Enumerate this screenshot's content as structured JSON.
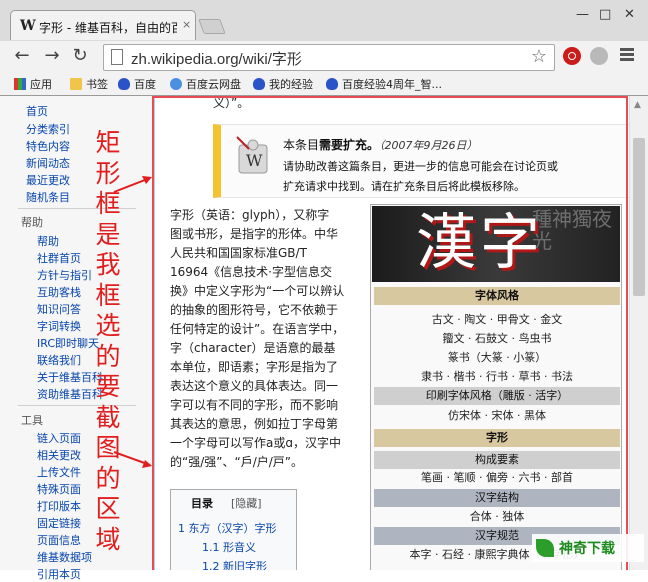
{
  "browser": {
    "tab_title": "字形 - 维基百科，自由的百科全书",
    "tab_icon": "W",
    "tab_close": "×",
    "url": "zh.wikipedia.org/wiki/字形",
    "window_min": "—",
    "window_max": "□",
    "window_close": "✕",
    "bookmarks": [
      "应用",
      "书签",
      "百度",
      "百度云网盘",
      "我的经验",
      "百度经验4周年_智..."
    ]
  },
  "sidebar": {
    "nav": [
      "首页",
      "分类索引",
      "特色内容",
      "新闻动态",
      "最近更改",
      "随机条目"
    ],
    "help_title": "帮助",
    "help_items": [
      "帮助",
      "社群首页",
      "方针与指引",
      "互助客栈",
      "知识问答",
      "字词转换",
      "IRC即时聊天",
      "联络我们",
      "关于维基百科",
      "资助维基百科"
    ],
    "tools_title": "工具",
    "tools_items": [
      "链入页面",
      "相关更改",
      "上传文件",
      "特殊页面",
      "打印版本",
      "固定链接",
      "页面信息",
      "维基数据项",
      "引用本页"
    ]
  },
  "annotation": "矩形框是我框选的要截图的区域",
  "page": {
    "top_fragment": "义）”。",
    "notice": {
      "prefix": "本条目",
      "bold": "需要扩充。",
      "date": "（2007年9月26日）",
      "line2": "请协助改善这篇条目，更进一步的信息可能会在讨论页或",
      "line3": "扩充请求中找到。请在扩充条目后将此模板移除。"
    },
    "article_lines": [
      "字形（英语：glyph），又称字",
      "图或书形，是指字的形体。中华",
      "人民共和国国家标准GB/T",
      "16964《信息技术·字型信息交",
      "换》中定义字形为“一个可以辨认",
      "的抽象的图形符号，它不依赖于",
      "任何特定的设计”。在语言学中，",
      "字（character）是语意的最基",
      "本单位，即语素；字形是指为了",
      "表达这个意义的具体表达。同一",
      "字可以有不同的字形，而不影响",
      "其表达的意思，例如拉丁字母第",
      "一个字母可以写作a或ɑ，汉字中",
      "的“强/强”、“戶/户/戸”。"
    ],
    "toc": {
      "title": "目录",
      "toggle": "[隐藏]",
      "items": [
        "1 东方（汉字）字形",
        "1.1 形音义",
        "1.2 新旧字形"
      ]
    },
    "infobox": {
      "banner": "漢字",
      "banner_bg": "種神獨夜光",
      "sections": {
        "style": "字体风格",
        "print": "印刷字体风格（雕版 · 活字）",
        "glyph": "字形",
        "elements": "构成要素",
        "structure": "汉字结构",
        "norms": "汉字规范"
      },
      "style_row1": "古文 · 陶文 · 甲骨文 · 金文",
      "style_row2": "籀文 · 石鼓文 · 鸟虫书",
      "style_row3": "篆书（大篆 · 小篆）",
      "style_row4": "隶书 · 楷书 · 行书 · 草书 · 书法",
      "print_row": "仿宋体 · 宋体 · 黑体",
      "elements_row": "笔画 · 笔顺 · 偏旁 · 六书 · 部首",
      "structure_row": "合体 · 独体",
      "norms_row": "本字 · 石经 · 康熙字典体（旧字形）"
    },
    "watermark": "神奇下载"
  }
}
